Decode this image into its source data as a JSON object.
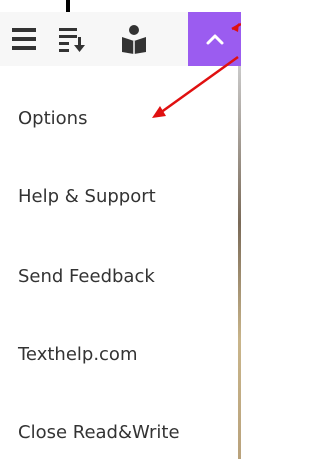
{
  "colors": {
    "accent": "#9b5cf0",
    "annotation_arrow": "#e01010",
    "toolbar_background": "#f7f7f7",
    "icon": "#333333"
  },
  "toolbar": {
    "icons": [
      "menu-lines-icon",
      "sort-down-icon",
      "reader-icon",
      "chevron-up-icon"
    ]
  },
  "menu": {
    "items": [
      {
        "label": "Options"
      },
      {
        "label": "Help & Support"
      },
      {
        "label": "Send Feedback"
      },
      {
        "label": "Texthelp.com"
      },
      {
        "label": "Close Read&Write"
      }
    ]
  }
}
